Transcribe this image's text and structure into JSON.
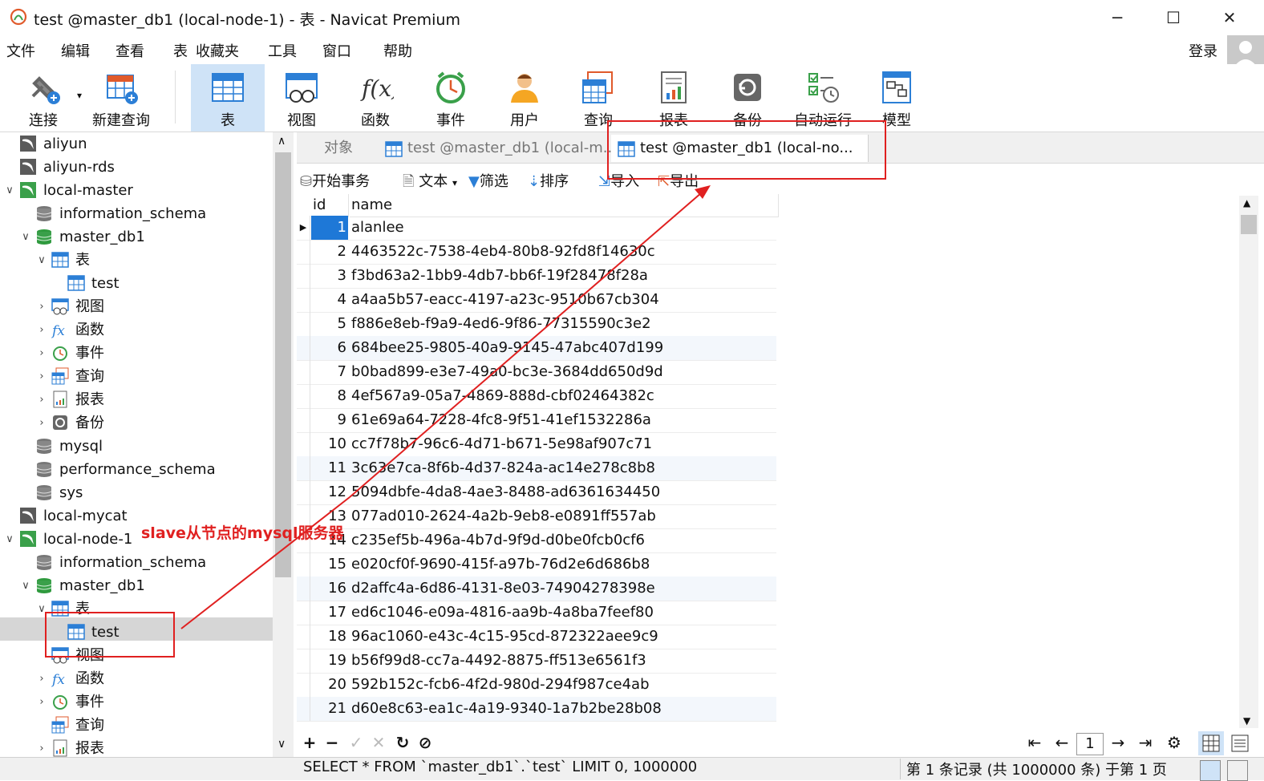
{
  "window": {
    "title": "test @master_db1 (local-node-1) - 表 - Navicat Premium",
    "min": "─",
    "max": "☐",
    "close": "✕"
  },
  "menu": [
    "文件",
    "编辑",
    "查看",
    "表",
    "收藏夹",
    "工具",
    "窗口",
    "帮助"
  ],
  "login": "登录",
  "toolbar": [
    {
      "label": "连接",
      "icon": "plug-icon"
    },
    {
      "label": "新建查询",
      "icon": "new-query-icon"
    },
    {
      "label": "表",
      "icon": "table-icon",
      "active": true
    },
    {
      "label": "视图",
      "icon": "view-icon"
    },
    {
      "label": "函数",
      "icon": "function-icon"
    },
    {
      "label": "事件",
      "icon": "clock-icon"
    },
    {
      "label": "用户",
      "icon": "user-icon"
    },
    {
      "label": "查询",
      "icon": "query-icon"
    },
    {
      "label": "报表",
      "icon": "report-icon"
    },
    {
      "label": "备份",
      "icon": "backup-icon"
    },
    {
      "label": "自动运行",
      "icon": "autorun-icon"
    },
    {
      "label": "模型",
      "icon": "model-icon"
    }
  ],
  "tree": [
    {
      "label": "aliyun",
      "level": 0,
      "icon": "mysql-conn-grey",
      "arrow": ""
    },
    {
      "label": "aliyun-rds",
      "level": 0,
      "icon": "mysql-conn-grey",
      "arrow": ""
    },
    {
      "label": "local-master",
      "level": 0,
      "icon": "mysql-conn-green",
      "arrow": "∨"
    },
    {
      "label": "information_schema",
      "level": 1,
      "icon": "db-grey",
      "arrow": ""
    },
    {
      "label": "master_db1",
      "level": 1,
      "icon": "db-green",
      "arrow": "∨"
    },
    {
      "label": "表",
      "level": 2,
      "icon": "table",
      "arrow": "∨"
    },
    {
      "label": "test",
      "level": 3,
      "icon": "table",
      "arrow": ""
    },
    {
      "label": "视图",
      "level": 2,
      "icon": "view",
      "arrow": "›"
    },
    {
      "label": "函数",
      "level": 2,
      "icon": "fx",
      "arrow": "›"
    },
    {
      "label": "事件",
      "level": 2,
      "icon": "clock",
      "arrow": "›"
    },
    {
      "label": "查询",
      "level": 2,
      "icon": "query",
      "arrow": "›"
    },
    {
      "label": "报表",
      "level": 2,
      "icon": "report",
      "arrow": "›"
    },
    {
      "label": "备份",
      "level": 2,
      "icon": "backup",
      "arrow": "›"
    },
    {
      "label": "mysql",
      "level": 1,
      "icon": "db-grey",
      "arrow": ""
    },
    {
      "label": "performance_schema",
      "level": 1,
      "icon": "db-grey",
      "arrow": ""
    },
    {
      "label": "sys",
      "level": 1,
      "icon": "db-grey",
      "arrow": ""
    },
    {
      "label": "local-mycat",
      "level": 0,
      "icon": "mysql-conn-grey",
      "arrow": ""
    },
    {
      "label": "local-node-1",
      "level": 0,
      "icon": "mysql-conn-green",
      "arrow": "∨"
    },
    {
      "label": "information_schema",
      "level": 1,
      "icon": "db-grey",
      "arrow": ""
    },
    {
      "label": "master_db1",
      "level": 1,
      "icon": "db-green",
      "arrow": "∨"
    },
    {
      "label": "表",
      "level": 2,
      "icon": "table",
      "arrow": "∨"
    },
    {
      "label": "test",
      "level": 3,
      "icon": "table",
      "arrow": "",
      "selected": true
    },
    {
      "label": "视图",
      "level": 2,
      "icon": "view",
      "arrow": ""
    },
    {
      "label": "函数",
      "level": 2,
      "icon": "fx",
      "arrow": "›"
    },
    {
      "label": "事件",
      "level": 2,
      "icon": "clock",
      "arrow": "›"
    },
    {
      "label": "查询",
      "level": 2,
      "icon": "query",
      "arrow": ""
    },
    {
      "label": "报表",
      "level": 2,
      "icon": "report",
      "arrow": "›"
    }
  ],
  "tabs": [
    {
      "label": "对象",
      "active": false
    },
    {
      "label": "test @master_db1 (local-m...",
      "active": false
    },
    {
      "label": "test @master_db1 (local-no...",
      "active": true
    }
  ],
  "subtoolbar": {
    "begin_tx": "开始事务",
    "text": "文本",
    "filter": "筛选",
    "sort": "排序",
    "import": "导入",
    "export": "导出"
  },
  "grid": {
    "columns": [
      "id",
      "name"
    ],
    "rows": [
      [
        "1",
        "alanlee"
      ],
      [
        "2",
        "4463522c-7538-4eb4-80b8-92fd8f14630c"
      ],
      [
        "3",
        "f3bd63a2-1bb9-4db7-bb6f-19f28478f28a"
      ],
      [
        "4",
        "a4aa5b57-eacc-4197-a23c-9510b67cb304"
      ],
      [
        "5",
        "f886e8eb-f9a9-4ed6-9f86-77315590c3e2"
      ],
      [
        "6",
        "684bee25-9805-40a9-9145-47abc407d199"
      ],
      [
        "7",
        "b0bad899-e3e7-49a0-bc3e-3684dd650d9d"
      ],
      [
        "8",
        "4ef567a9-05a7-4869-888d-cbf02464382c"
      ],
      [
        "9",
        "61e69a64-7228-4fc8-9f51-41ef1532286a"
      ],
      [
        "10",
        "cc7f78b7-96c6-4d71-b671-5e98af907c71"
      ],
      [
        "11",
        "3c63e7ca-8f6b-4d37-824a-ac14e278c8b8"
      ],
      [
        "12",
        "5094dbfe-4da8-4ae3-8488-ad6361634450"
      ],
      [
        "13",
        "077ad010-2624-4a2b-9eb8-e0891ff557ab"
      ],
      [
        "14",
        "c235ef5b-496a-4b7d-9f9d-d0be0fcb0cf6"
      ],
      [
        "15",
        "e020cf0f-9690-415f-a97b-76d2e6d686b8"
      ],
      [
        "16",
        "d2affc4a-6d86-4131-8e03-74904278398e"
      ],
      [
        "17",
        "ed6c1046-e09a-4816-aa9b-4a8ba7feef80"
      ],
      [
        "18",
        "96ac1060-e43c-4c15-95cd-872322aee9c9"
      ],
      [
        "19",
        "b56f99d8-cc7a-4492-8875-ff513e6561f3"
      ],
      [
        "20",
        "592b152c-fcb6-4f2d-980d-294f987ce4ab"
      ],
      [
        "21",
        "d60e8c63-ea1c-4a19-9340-1a7b2be28b08"
      ]
    ]
  },
  "nav": {
    "add": "+",
    "delete": "−",
    "apply": "✓",
    "discard": "✕",
    "refresh": "↻",
    "stop": "⊘",
    "first": "⇤",
    "prev": "←",
    "page": "1",
    "next": "→",
    "last": "⇥",
    "settings": "⚙"
  },
  "status": {
    "sql": "SELECT * FROM `master_db1`.`test` LIMIT 0, 1000000",
    "records": "第 1 条记录 (共 1000000 条) 于第 1 页"
  },
  "annotation": {
    "text": "slave从节点的mysql服务器",
    "color": "#e02020"
  }
}
